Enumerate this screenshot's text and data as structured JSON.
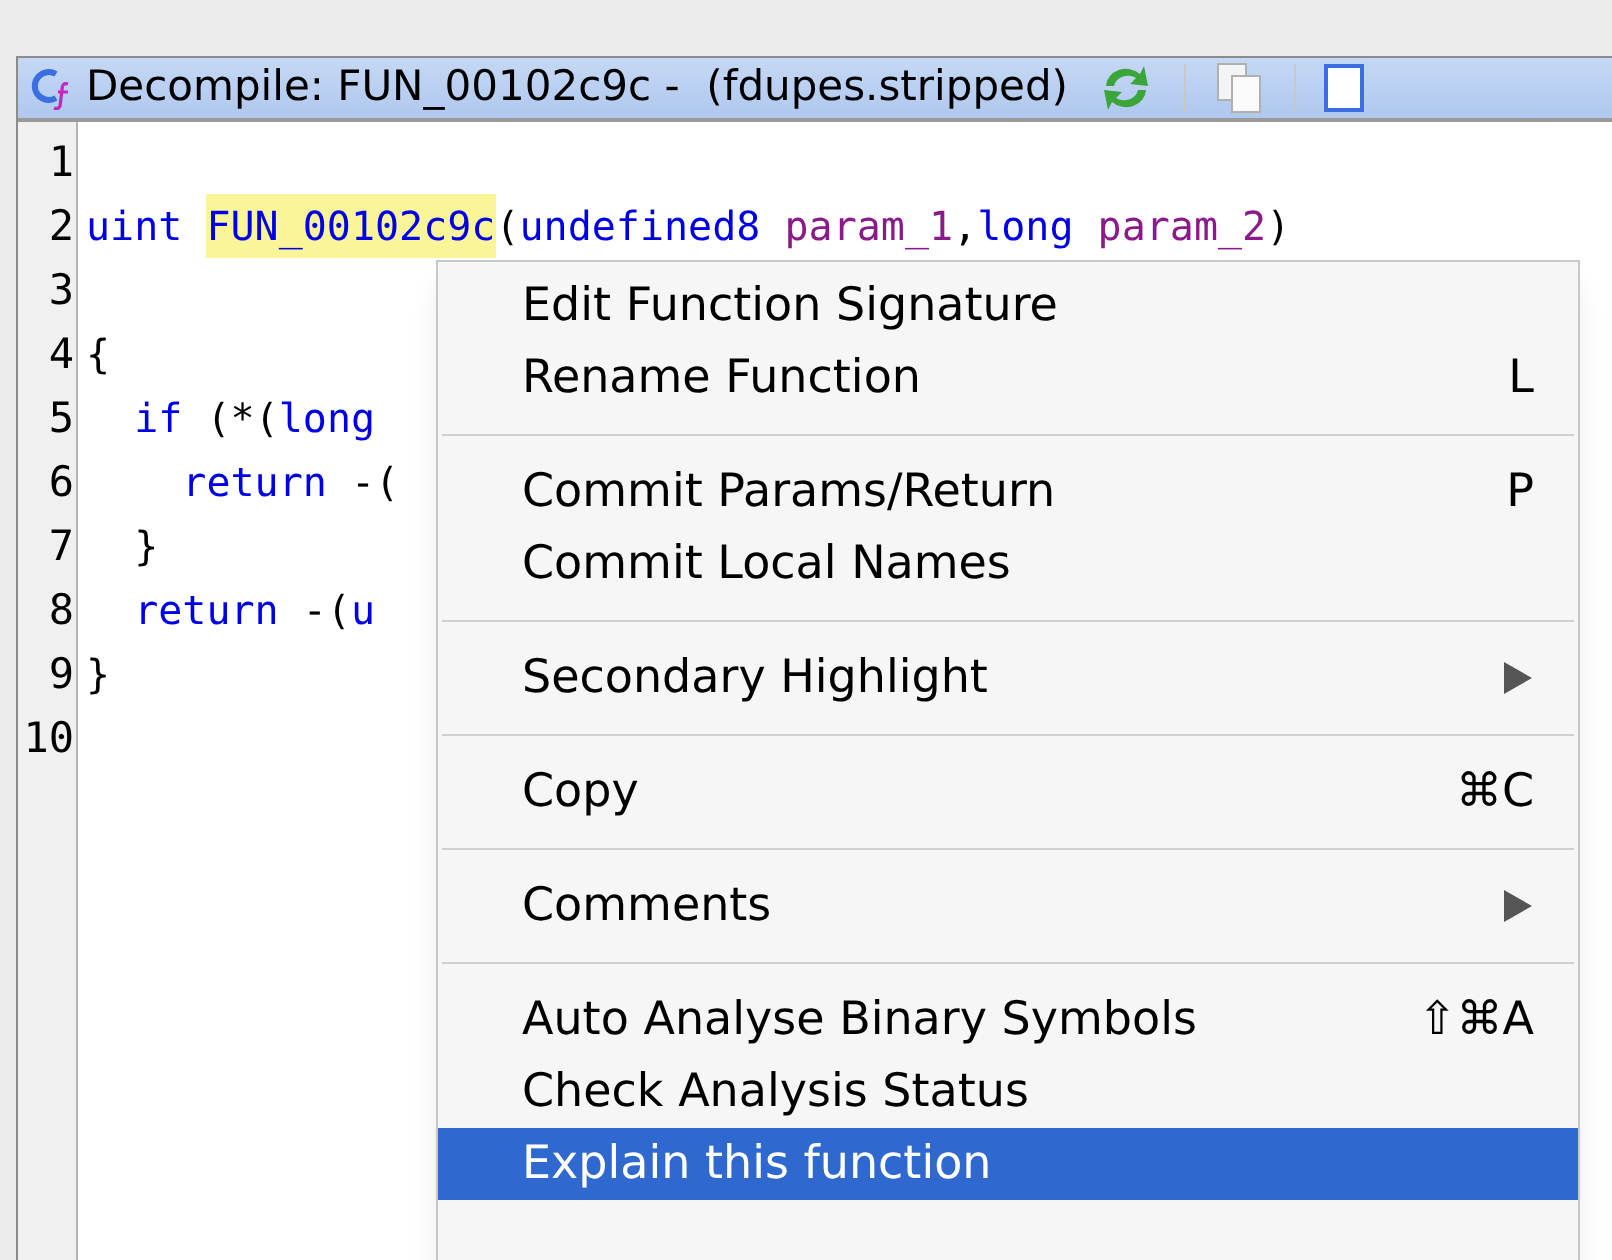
{
  "panel": {
    "title": "Decompile: FUN_00102c9c -  (fdupes.stripped)"
  },
  "code": {
    "lines": [
      {
        "number": "1"
      },
      {
        "number": "2",
        "tokens": [
          {
            "kind": "keyword",
            "text": "uint "
          },
          {
            "kind": "function",
            "text": "FUN_00102c9c",
            "highlighted": true
          },
          {
            "kind": "plain",
            "text": "("
          },
          {
            "kind": "keyword",
            "text": "undefined8 "
          },
          {
            "kind": "variable",
            "text": "param_1"
          },
          {
            "kind": "plain",
            "text": ","
          },
          {
            "kind": "keyword",
            "text": "long "
          },
          {
            "kind": "variable",
            "text": "param_2"
          },
          {
            "kind": "plain",
            "text": ")"
          }
        ]
      },
      {
        "number": "3"
      },
      {
        "number": "4",
        "tokens": [
          {
            "kind": "plain",
            "text": "{"
          }
        ]
      },
      {
        "number": "5",
        "tokens": [
          {
            "kind": "keyword",
            "text": "  if"
          },
          {
            "kind": "plain",
            "text": " (*("
          },
          {
            "kind": "keyword",
            "text": "long"
          }
        ]
      },
      {
        "number": "6",
        "tokens": [
          {
            "kind": "keyword",
            "text": "    return"
          },
          {
            "kind": "plain",
            "text": " -("
          }
        ]
      },
      {
        "number": "7",
        "tokens": [
          {
            "kind": "plain",
            "text": "  }"
          }
        ]
      },
      {
        "number": "8",
        "tokens": [
          {
            "kind": "keyword",
            "text": "  return"
          },
          {
            "kind": "plain",
            "text": " -("
          },
          {
            "kind": "keyword",
            "text": "u"
          }
        ]
      },
      {
        "number": "9",
        "tokens": [
          {
            "kind": "plain",
            "text": "}"
          }
        ]
      },
      {
        "number": "10"
      }
    ]
  },
  "context_menu": {
    "items": [
      {
        "kind": "item",
        "label": "Edit Function Signature",
        "selected": false
      },
      {
        "kind": "item",
        "label": "Rename Function",
        "shortcut": "L",
        "selected": false
      },
      {
        "kind": "separator"
      },
      {
        "kind": "item",
        "label": "Commit Params/Return",
        "shortcut": "P",
        "selected": false
      },
      {
        "kind": "item",
        "label": "Commit Local Names",
        "selected": false
      },
      {
        "kind": "separator"
      },
      {
        "kind": "submenu",
        "label": "Secondary Highlight",
        "selected": false
      },
      {
        "kind": "separator"
      },
      {
        "kind": "item",
        "label": "Copy",
        "shortcut": "⌘C",
        "selected": false
      },
      {
        "kind": "separator"
      },
      {
        "kind": "submenu",
        "label": "Comments",
        "selected": false
      },
      {
        "kind": "separator"
      },
      {
        "kind": "item",
        "label": "Auto Analyse Binary Symbols",
        "shortcut": "⇧⌘A",
        "selected": false
      },
      {
        "kind": "item",
        "label": "Check Analysis Status",
        "selected": false
      },
      {
        "kind": "item",
        "label": "Explain this function",
        "selected": true
      }
    ]
  }
}
